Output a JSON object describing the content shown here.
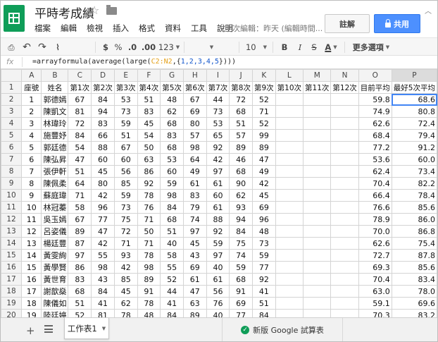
{
  "app": {
    "title": "平時考成績",
    "star_glyph": "☆",
    "menu": [
      "檔案",
      "編輯",
      "檢視",
      "插入",
      "格式",
      "資料",
      "工具",
      "說明"
    ],
    "last_edit": "上次編輯：昨天 (編輯時間...",
    "comment_label": "註解",
    "share_label": "共用",
    "accent_color": "#0f9d58",
    "share_color": "#4d90fe"
  },
  "toolbar": {
    "print_glyph": "⎙",
    "undo_glyph": "↶",
    "redo_glyph": "↷",
    "paint_glyph": "⌇",
    "currency": "$",
    "percent": "%",
    "decrease_decimal": ".0",
    "increase_decimal": ".00",
    "number_format": "123",
    "font_size": "10",
    "bold": "B",
    "italic": "I",
    "strike": "S",
    "text_color": "A",
    "more": "更多選項"
  },
  "formula": {
    "fx": "fx",
    "prefix": "=arrayformula(average(large(",
    "range": "C2:N2",
    "middle": ",{",
    "array": "1,2,3,4,5",
    "suffix": "})))"
  },
  "grid": {
    "columns": [
      "A",
      "B",
      "C",
      "D",
      "E",
      "F",
      "G",
      "H",
      "I",
      "J",
      "K",
      "L",
      "M",
      "N",
      "O",
      "P"
    ],
    "header_row": [
      "座號",
      "姓名",
      "第1次",
      "第2次",
      "第3次",
      "第4次",
      "第5次",
      "第6次",
      "第7次",
      "第8次",
      "第9次",
      "第10次",
      "第11次",
      "第12次",
      "目前平均",
      "最好5次平均"
    ],
    "rows": [
      [
        "1",
        "郭德嫣",
        "67",
        "84",
        "53",
        "51",
        "48",
        "67",
        "44",
        "72",
        "52",
        "",
        "",
        "",
        "59.8",
        "68.6"
      ],
      [
        "2",
        "陳凱文",
        "81",
        "94",
        "73",
        "83",
        "62",
        "69",
        "73",
        "68",
        "71",
        "",
        "",
        "",
        "74.9",
        "80.8"
      ],
      [
        "3",
        "林瑋玲",
        "72",
        "83",
        "59",
        "45",
        "68",
        "80",
        "53",
        "51",
        "52",
        "",
        "",
        "",
        "62.6",
        "72.4"
      ],
      [
        "4",
        "施豐妤",
        "84",
        "66",
        "51",
        "54",
        "83",
        "57",
        "65",
        "57",
        "99",
        "",
        "",
        "",
        "68.4",
        "79.4"
      ],
      [
        "5",
        "郭廷德",
        "54",
        "88",
        "67",
        "50",
        "68",
        "98",
        "92",
        "89",
        "89",
        "",
        "",
        "",
        "77.2",
        "91.2"
      ],
      [
        "6",
        "陳弘昇",
        "47",
        "60",
        "60",
        "63",
        "53",
        "64",
        "42",
        "46",
        "47",
        "",
        "",
        "",
        "53.6",
        "60.0"
      ],
      [
        "7",
        "張伊軒",
        "51",
        "45",
        "56",
        "86",
        "60",
        "49",
        "97",
        "68",
        "49",
        "",
        "",
        "",
        "62.4",
        "73.4"
      ],
      [
        "8",
        "陳佩柔",
        "64",
        "80",
        "85",
        "92",
        "59",
        "61",
        "61",
        "90",
        "42",
        "",
        "",
        "",
        "70.4",
        "82.2"
      ],
      [
        "9",
        "蘇庭瑋",
        "71",
        "42",
        "59",
        "78",
        "98",
        "83",
        "60",
        "62",
        "45",
        "",
        "",
        "",
        "66.4",
        "78.4"
      ],
      [
        "10",
        "林冠蓁",
        "58",
        "96",
        "73",
        "76",
        "84",
        "79",
        "61",
        "93",
        "69",
        "",
        "",
        "",
        "76.6",
        "85.6"
      ],
      [
        "11",
        "吳玉嫣",
        "67",
        "77",
        "75",
        "71",
        "68",
        "74",
        "88",
        "94",
        "96",
        "",
        "",
        "",
        "78.9",
        "86.0"
      ],
      [
        "12",
        "呂姿儀",
        "89",
        "47",
        "72",
        "50",
        "51",
        "97",
        "92",
        "84",
        "48",
        "",
        "",
        "",
        "70.0",
        "86.8"
      ],
      [
        "13",
        "楊廷豐",
        "87",
        "42",
        "71",
        "71",
        "40",
        "45",
        "59",
        "75",
        "73",
        "",
        "",
        "",
        "62.6",
        "75.4"
      ],
      [
        "14",
        "黃雯絢",
        "97",
        "55",
        "93",
        "78",
        "58",
        "43",
        "97",
        "74",
        "59",
        "",
        "",
        "",
        "72.7",
        "87.8"
      ],
      [
        "15",
        "黃學賢",
        "86",
        "98",
        "42",
        "98",
        "55",
        "69",
        "40",
        "59",
        "77",
        "",
        "",
        "",
        "69.3",
        "85.6"
      ],
      [
        "16",
        "黃世育",
        "83",
        "43",
        "85",
        "89",
        "52",
        "61",
        "61",
        "68",
        "92",
        "",
        "",
        "",
        "70.4",
        "83.4"
      ],
      [
        "17",
        "謝歆燊",
        "68",
        "84",
        "45",
        "91",
        "44",
        "47",
        "56",
        "91",
        "41",
        "",
        "",
        "",
        "63.0",
        "78.0"
      ],
      [
        "18",
        "陳儀如",
        "51",
        "41",
        "62",
        "78",
        "41",
        "63",
        "76",
        "69",
        "51",
        "",
        "",
        "",
        "59.1",
        "69.6"
      ],
      [
        "19",
        "陸廷婷",
        "52",
        "81",
        "78",
        "48",
        "84",
        "89",
        "40",
        "77",
        "84",
        "",
        "",
        "",
        "70.3",
        "83.2"
      ]
    ],
    "low_color": "#c0392b"
  },
  "bottom": {
    "add_sheet": "+",
    "sheet_tab": "工作表1",
    "new_version": "新版 Google 試算表"
  }
}
